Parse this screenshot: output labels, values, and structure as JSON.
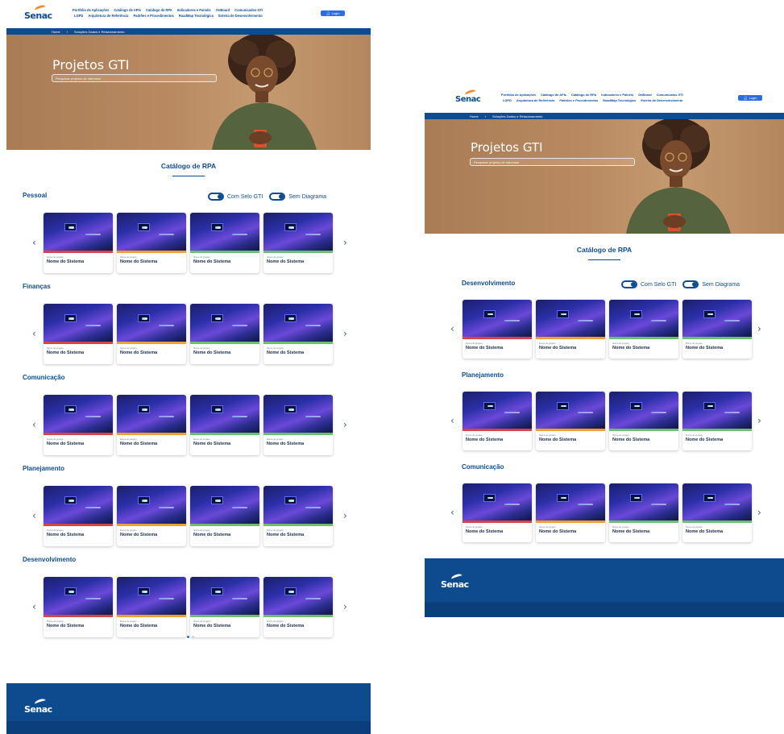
{
  "brand": {
    "logo_text": "Senac",
    "accent": "#0d4c93",
    "orange": "#f28c28"
  },
  "nav": {
    "row1": [
      "Portfólio de Aplicações",
      "Catálogo de APIs",
      "Catálogo de RPA",
      "Indicadores e Painéis",
      "OnBoard",
      "Comunicados GTI"
    ],
    "row2": [
      "LGPD",
      "Arquitetura de Referência",
      "Padrões e Procedimentos",
      "RoadMap Tecnológico",
      "Esteira de Desenvolvimento"
    ],
    "login_label": "Login",
    "login_icon": "user-icon"
  },
  "breadcrumb": {
    "home": "Home",
    "current": "Soluções Dados e Relacionamento"
  },
  "hero": {
    "title": "Projetos GTI",
    "search_placeholder": "Pesquisar projetos de interesse"
  },
  "catalog_title": "Catálogo de RPA",
  "toggles": {
    "selo": "Com Selo GTI",
    "diagrama": "Sem Diagrama"
  },
  "card_defaults": {
    "small_label": "Nome do projeto",
    "name": "Nome do Sistema"
  },
  "stripe_colors": {
    "red": "#d64545",
    "orange": "#f0a030",
    "green": "#6dbf6d"
  },
  "left_sections": [
    {
      "title": "Pessoal"
    },
    {
      "title": "Finanças"
    },
    {
      "title": "Comunicação"
    },
    {
      "title": "Planejamento"
    },
    {
      "title": "Desenvolvimento"
    }
  ],
  "right_sections": [
    {
      "title": "Desenvolvimento"
    },
    {
      "title": "Planejamento"
    },
    {
      "title": "Comunicação"
    }
  ],
  "card_stripes": [
    "red",
    "orange",
    "green",
    "green"
  ],
  "pagination": {
    "pages": 2,
    "active": 1
  },
  "footer": {
    "logo_text": "Senac"
  }
}
